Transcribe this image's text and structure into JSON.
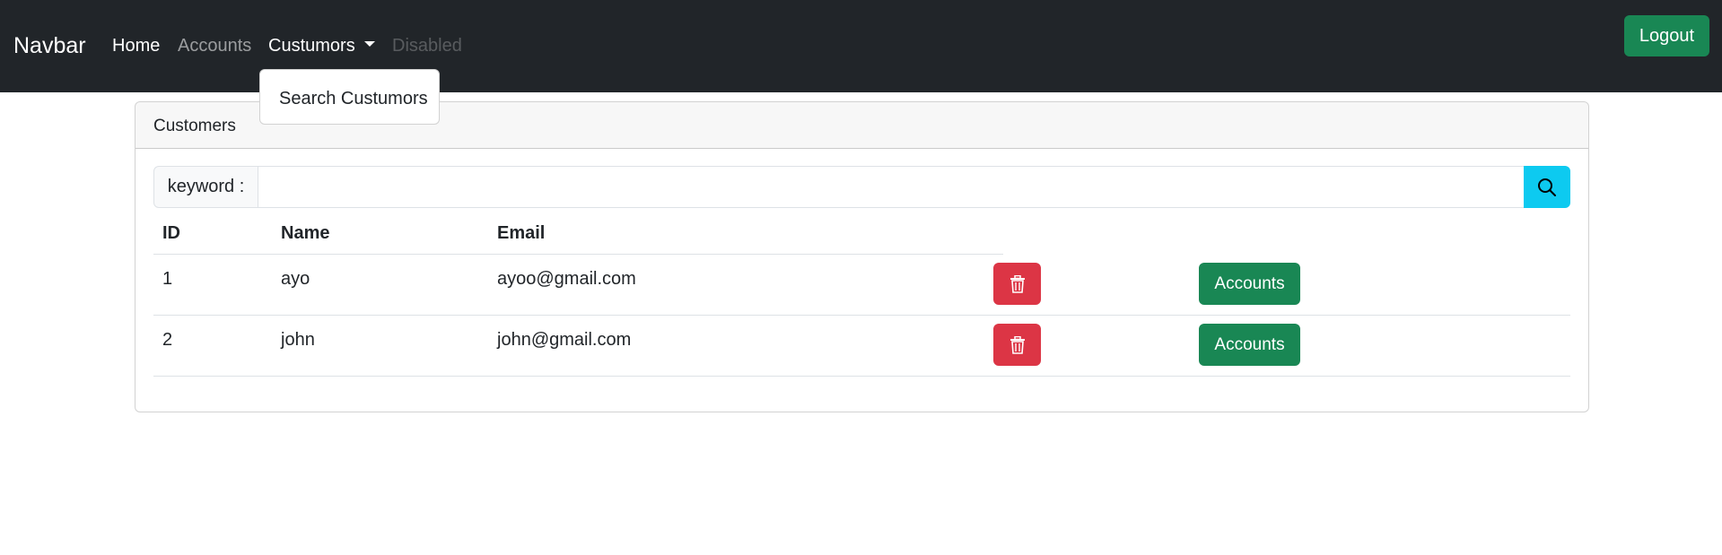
{
  "navbar": {
    "brand": "Navbar",
    "links": [
      "Home",
      "Accounts",
      "Custumors",
      "Disabled"
    ],
    "logout_label": "Logout"
  },
  "dropdown": {
    "items": [
      "Search Custumors"
    ]
  },
  "card": {
    "title": "Customers",
    "search": {
      "label": "keyword :",
      "value": "",
      "placeholder": "",
      "button_icon": "search-icon"
    },
    "table": {
      "headers": [
        "ID",
        "Name",
        "Email"
      ],
      "rows": [
        {
          "id": "1",
          "name": "ayo",
          "email": "ayoo@gmail.com"
        },
        {
          "id": "2",
          "name": "john",
          "email": "john@gmail.com"
        }
      ],
      "delete_icon": "trash-icon",
      "accounts_label": "Accounts"
    }
  },
  "colors": {
    "navbar_bg": "#212529",
    "success": "#198754",
    "danger": "#dc3545",
    "info": "#0dcaf0"
  }
}
